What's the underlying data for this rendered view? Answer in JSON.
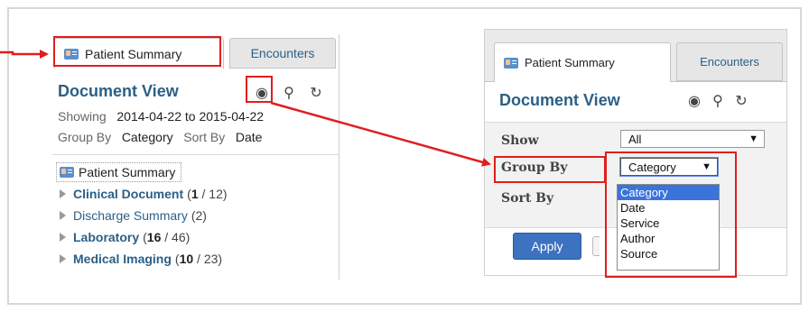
{
  "left_panel": {
    "tabs": [
      "Patient Summary",
      "Encounters"
    ],
    "title": "Document View",
    "tool_icons": [
      "eye-icon",
      "search-icon",
      "refresh-icon"
    ],
    "showing_label": "Showing",
    "showing_value": "2014-04-22 to 2015-04-22",
    "group_by_label": "Group By",
    "group_by_value": "Category",
    "sort_by_label": "Sort By",
    "sort_by_value": "Date",
    "tree_root": "Patient Summary",
    "tree_items": [
      {
        "name": "Clinical Document",
        "bold": true,
        "new": "1",
        "total": "12"
      },
      {
        "name": "Discharge Summary",
        "bold": false,
        "count": "(2)"
      },
      {
        "name": "Laboratory",
        "bold": true,
        "new": "16",
        "total": "46"
      },
      {
        "name": "Medical Imaging",
        "bold": true,
        "new": "10",
        "total": "23"
      }
    ]
  },
  "right_panel": {
    "tabs": [
      "Patient Summary",
      "Encounters"
    ],
    "title": "Document View",
    "show_label": "Show",
    "show_value": "All",
    "group_by_label": "Group By",
    "group_by_value": "Category",
    "sort_by_label": "Sort By",
    "apply_label": "Apply",
    "dropdown_options": [
      "Category",
      "Date",
      "Service",
      "Author",
      "Source"
    ],
    "selected_option": "Category"
  },
  "colors": {
    "accent": "#2b5f86",
    "annotation": "#e01e1e",
    "button": "#3c72bf",
    "selection": "#3a73d9"
  }
}
